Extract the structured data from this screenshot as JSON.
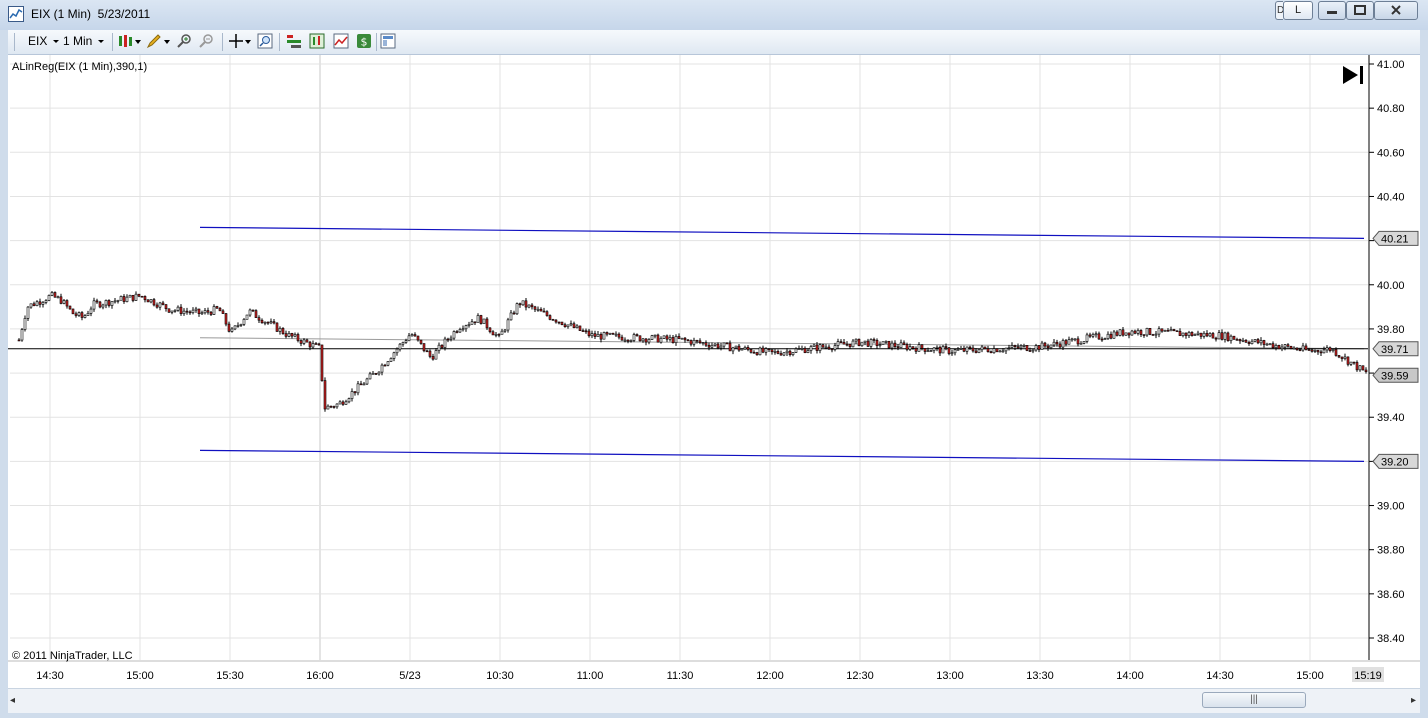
{
  "window": {
    "title": "EIX (1 Min)  5/23/2011",
    "controls": {
      "left_button": "L",
      "partial_button": "D"
    }
  },
  "toolbar": {
    "instrument": "EIX",
    "interval": "1 Min",
    "icons": [
      "candlestick-style-icon",
      "drawing-pencil-icon",
      "zoom-in-icon",
      "zoom-out-icon",
      "crosshair-icon",
      "magnifier-icon",
      "indicators-icon",
      "strategies-icon",
      "chart-properties-icon",
      "dollar-icon",
      "templates-icon"
    ]
  },
  "chart": {
    "indicator_label": "ALinReg(EIX (1 Min),390,1)",
    "copyright": "© 2011 NinjaTrader, LLC",
    "scroll_end_icon": "scroll-to-end-icon",
    "colors": {
      "background": "#ffffff",
      "grid": "#e3e3e3",
      "channel": "#1010c0",
      "midline": "#000000",
      "down_bar": "#cc2222",
      "up_bar": "#ffffff"
    }
  },
  "chart_data": {
    "type": "candlestick",
    "title": "",
    "x_ticks": [
      "14:30",
      "15:00",
      "15:30",
      "16:00",
      "5/23",
      "10:30",
      "11:00",
      "11:30",
      "12:00",
      "12:30",
      "13:00",
      "13:30",
      "14:00",
      "14:30",
      "15:00"
    ],
    "x_last": "15:19",
    "y_ticks": [
      "41.00",
      "40.80",
      "40.60",
      "40.40",
      "40.20",
      "40.00",
      "39.80",
      "39.60",
      "39.40",
      "39.20",
      "39.00",
      "38.80",
      "38.60",
      "38.40"
    ],
    "ylim": [
      38.35,
      41.0
    ],
    "price_markers": [
      "40.21",
      "39.71",
      "39.59",
      "39.20"
    ],
    "channel": {
      "start_tick": "15:20",
      "upper": [
        40.26,
        40.21
      ],
      "middle": [
        39.76,
        39.71
      ],
      "lower": [
        39.25,
        39.2
      ]
    },
    "horizontal_line": 39.71,
    "price_path": [
      {
        "t": "14:15",
        "p": 39.75
      },
      {
        "t": "14:20",
        "p": 39.9
      },
      {
        "t": "14:30",
        "p": 39.95
      },
      {
        "t": "14:35",
        "p": 39.93
      },
      {
        "t": "14:40",
        "p": 39.87
      },
      {
        "t": "14:45",
        "p": 39.85
      },
      {
        "t": "14:50",
        "p": 39.91
      },
      {
        "t": "15:00",
        "p": 39.95
      },
      {
        "t": "15:10",
        "p": 39.89
      },
      {
        "t": "15:20",
        "p": 39.87
      },
      {
        "t": "15:25",
        "p": 39.89
      },
      {
        "t": "15:30",
        "p": 39.78
      },
      {
        "t": "15:40",
        "p": 39.88
      },
      {
        "t": "15:55",
        "p": 39.77
      },
      {
        "t": "16:00",
        "p": 39.71
      },
      {
        "t": "16:00b",
        "p": 39.44
      },
      {
        "t": "16:10",
        "p": 39.46
      },
      {
        "t": "16:20",
        "p": 39.6
      },
      {
        "t": "5/23",
        "p": 39.78
      },
      {
        "t": "10:15",
        "p": 39.67
      },
      {
        "t": "10:25",
        "p": 39.81
      },
      {
        "t": "10:35",
        "p": 39.85
      },
      {
        "t": "10:40",
        "p": 39.76
      },
      {
        "t": "10:50",
        "p": 39.92
      },
      {
        "t": "11:00",
        "p": 39.77
      },
      {
        "t": "11:30",
        "p": 39.75
      },
      {
        "t": "12:00",
        "p": 39.69
      },
      {
        "t": "12:30",
        "p": 39.74
      },
      {
        "t": "13:00",
        "p": 39.7
      },
      {
        "t": "13:30",
        "p": 39.72
      },
      {
        "t": "14:00",
        "p": 39.79
      },
      {
        "t": "14:30",
        "p": 39.77
      },
      {
        "t": "14:45",
        "p": 39.73
      },
      {
        "t": "15:00",
        "p": 39.7
      },
      {
        "t": "15:10",
        "p": 39.71
      },
      {
        "t": "15:19",
        "p": 39.59
      }
    ]
  },
  "scrollbar": {
    "left_arrow": "◂",
    "right_arrow": "▸",
    "grip": "|||"
  }
}
